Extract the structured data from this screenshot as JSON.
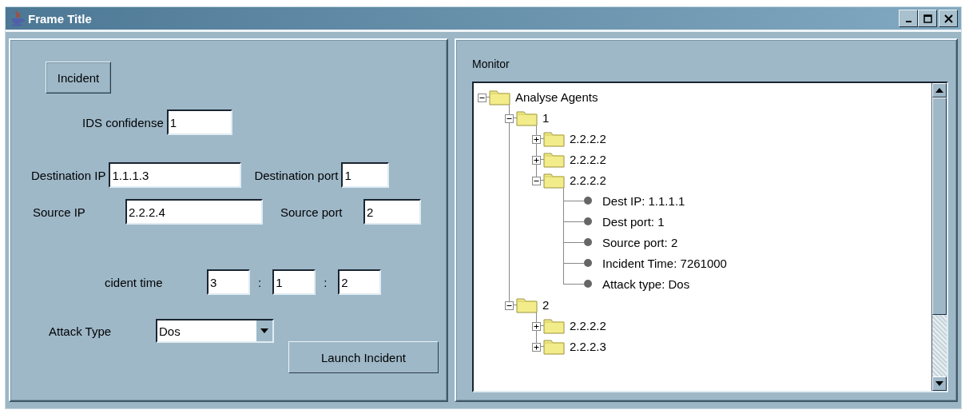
{
  "window": {
    "title": "Frame Title"
  },
  "incident_panel": {
    "incident_button": "Incident",
    "ids_confidence": {
      "label": "IDS confidense",
      "value": "1"
    },
    "destination_ip": {
      "label": "Destination IP",
      "value": "1.1.1.3"
    },
    "destination_port": {
      "label": "Destination port",
      "value": "1"
    },
    "source_ip": {
      "label": "Source IP",
      "value": "2.2.2.4"
    },
    "source_port": {
      "label": "Source port",
      "value": "2"
    },
    "incident_time": {
      "label": "cident time",
      "values": [
        "3",
        "1",
        "2"
      ],
      "separators": [
        ":",
        ":"
      ]
    },
    "attack_type": {
      "label": "Attack Type",
      "value": "Dos"
    },
    "launch_button": "Launch Incident"
  },
  "monitor": {
    "title": "Monitor",
    "tree": [
      {
        "label": "Analyse Agents",
        "kind": "folder",
        "expanded": true,
        "children": [
          {
            "label": "1",
            "kind": "folder",
            "expanded": true,
            "children": [
              {
                "label": "2.2.2.2",
                "kind": "folder",
                "expanded": false
              },
              {
                "label": "2.2.2.2",
                "kind": "folder",
                "expanded": false
              },
              {
                "label": "2.2.2.2",
                "kind": "folder",
                "expanded": true,
                "children": [
                  {
                    "label": "Dest IP: 1.1.1.1",
                    "kind": "leaf"
                  },
                  {
                    "label": "Dest port: 1",
                    "kind": "leaf"
                  },
                  {
                    "label": "Source port: 2",
                    "kind": "leaf"
                  },
                  {
                    "label": "Incident Time: 7261000",
                    "kind": "leaf"
                  },
                  {
                    "label": "Attack type: Dos",
                    "kind": "leaf"
                  }
                ]
              }
            ]
          },
          {
            "label": "2",
            "kind": "folder",
            "expanded": true,
            "children": [
              {
                "label": "2.2.2.2",
                "kind": "folder",
                "expanded": false
              },
              {
                "label": "2.2.2.3",
                "kind": "folder",
                "expanded": false
              }
            ]
          }
        ]
      }
    ]
  }
}
